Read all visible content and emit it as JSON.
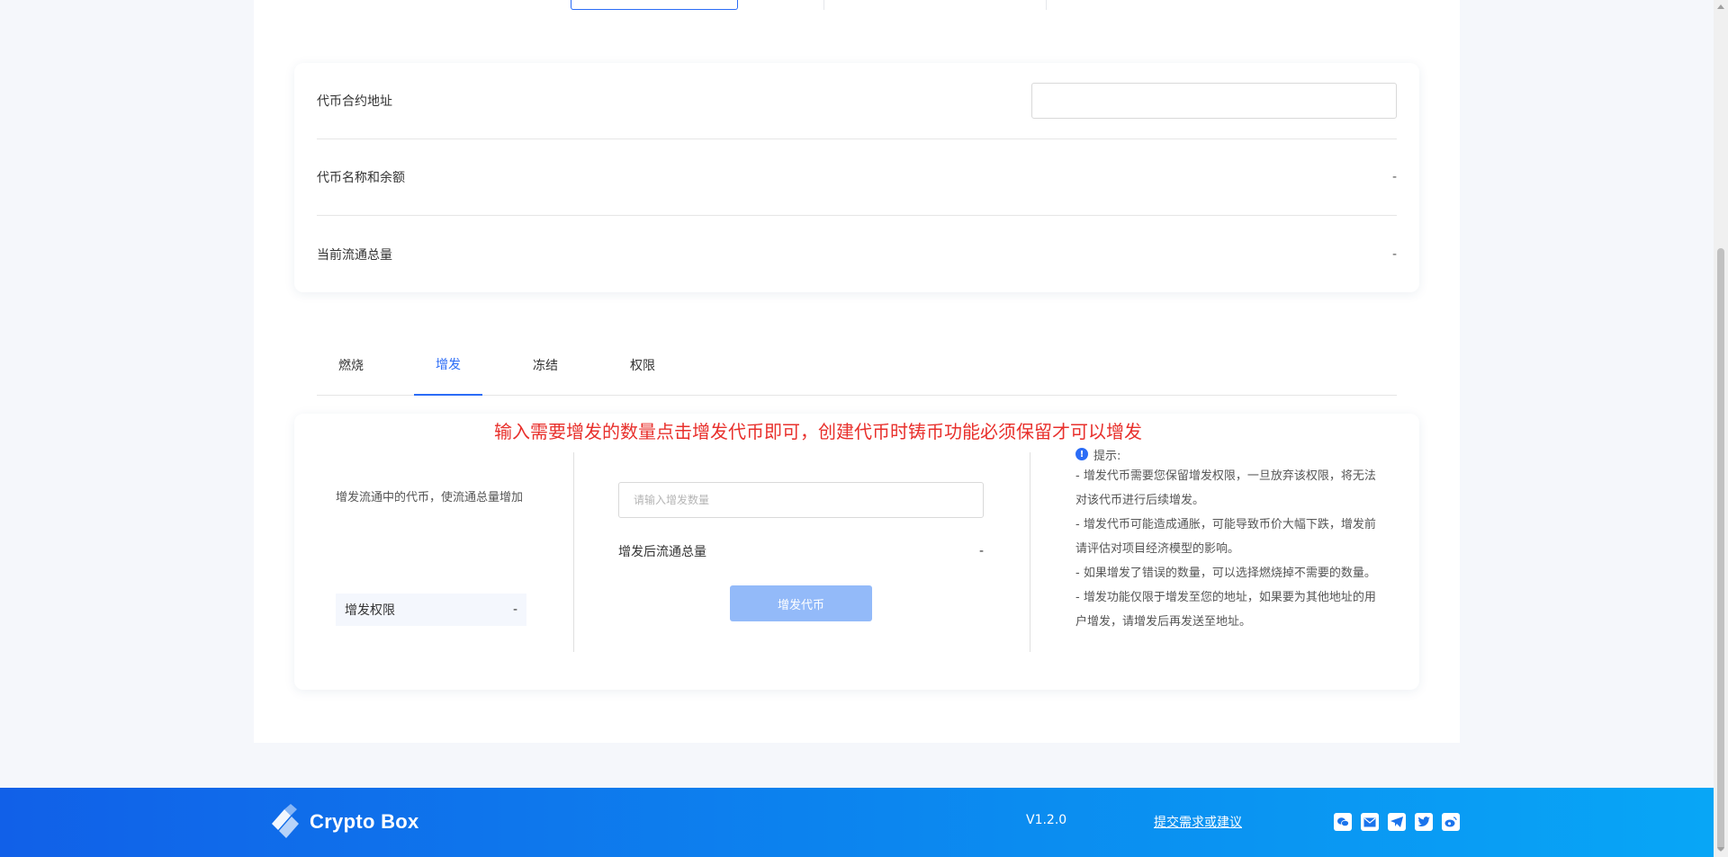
{
  "info": {
    "contract_label": "代币合约地址",
    "contract_value": "",
    "name_balance_label": "代币名称和余额",
    "name_balance_value": "-",
    "supply_label": "当前流通总量",
    "supply_value": "-"
  },
  "tabs": [
    {
      "label": "燃烧",
      "active": false
    },
    {
      "label": "增发",
      "active": true
    },
    {
      "label": "冻结",
      "active": false
    },
    {
      "label": "权限",
      "active": false
    }
  ],
  "mint": {
    "annotation": "输入需要增发的数量点击增发代币即可，创建代币时铸币功能必须保留才可以增发",
    "description": "增发流通中的代币，使流通总量增加",
    "permission_label": "增发权限",
    "permission_value": "-",
    "amount_placeholder": "请输入增发数量",
    "after_label": "增发后流通总量",
    "after_value": "-",
    "button_label": "增发代币"
  },
  "tips": {
    "title": "提示:",
    "lines": [
      "- 增发代币需要您保留增发权限，一旦放弃该权限，将无法对该代币进行后续增发。",
      "- 增发代币可能造成通胀，可能导致币价大幅下跌，增发前请评估对项目经济模型的影响。",
      "- 如果增发了错误的数量，可以选择燃烧掉不需要的数量。",
      "- 增发功能仅限于增发至您的地址，如果要为其他地址的用户增发，请增发后再发送至地址。"
    ]
  },
  "footer": {
    "brand": "Crypto Box",
    "version": "V1.2.0",
    "feedback": "提交需求或建议",
    "socials": [
      "wechat-icon",
      "mail-icon",
      "telegram-icon",
      "twitter-icon",
      "weibo-icon"
    ]
  },
  "colors": {
    "accent": "#2b6cf6",
    "annotation": "#e8302c",
    "button_disabled": "#93baf9"
  }
}
